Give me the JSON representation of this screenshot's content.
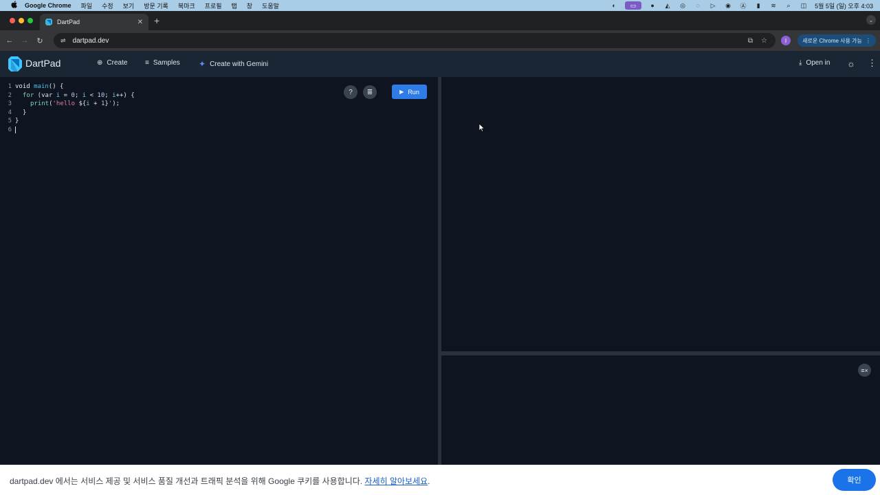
{
  "menubar": {
    "apple": "",
    "app_name": "Google Chrome",
    "items": [
      "파일",
      "수정",
      "보기",
      "방문 기록",
      "북마크",
      "프로필",
      "탭",
      "창",
      "도움말"
    ],
    "clock": "5월 5일 (일) 오후 4:03",
    "status_icons": [
      "screen-mirroring-icon",
      "screen-record-icon",
      "colorsync-icon",
      "font-icon",
      "creative-cloud-icon",
      "vpn-icon",
      "play-icon",
      "user-icon",
      "input-a-icon",
      "battery-icon",
      "wifi-icon",
      "search-icon",
      "control-center-icon"
    ]
  },
  "tab": {
    "title": "DartPad"
  },
  "toolbar": {
    "url": "dartpad.dev",
    "profile_initial": "I",
    "update_chip": "새로운 Chrome 사용 가능"
  },
  "appbar": {
    "title": "DartPad",
    "create": "Create",
    "samples": "Samples",
    "gemini": "Create with Gemini",
    "open_in": "Open in"
  },
  "editor": {
    "line_numbers": [
      "1",
      "2",
      "3",
      "4",
      "5",
      "6"
    ],
    "run_label": "Run",
    "code": {
      "l1_void": "void",
      "l1_main": "main",
      "l1_rest": "() {",
      "l2_for": "for",
      "l2_a": " (var ",
      "l2_i1": "i",
      "l2_b": " = ",
      "l2_n0": "0",
      "l2_c": "; ",
      "l2_i2": "i",
      "l2_d": " < ",
      "l2_n10": "10",
      "l2_e": "; ",
      "l2_i3": "i",
      "l2_f": "++) {",
      "l3_print": "print",
      "l3_a": "(",
      "l3_str": "'hello ",
      "l3_interp_open": "${",
      "l3_i": "i",
      "l3_plus": " + ",
      "l3_n1": "1",
      "l3_interp_close": "}",
      "l3_str_end": "'",
      "l3_end": ");",
      "l4": "}",
      "l5": "}"
    }
  },
  "cookie": {
    "message": "dartpad.dev 에서는 서비스 제공 및 서비스 품질 개선과 트래픽 분석을 위해 Google 쿠키를 사용합니다. ",
    "learn_more": "자세히 알아보세요",
    "period": ".",
    "ok": "확인"
  },
  "colors": {
    "accent": "#2f7ce8",
    "background": "#0e1520",
    "appbar": "#1b2634"
  }
}
